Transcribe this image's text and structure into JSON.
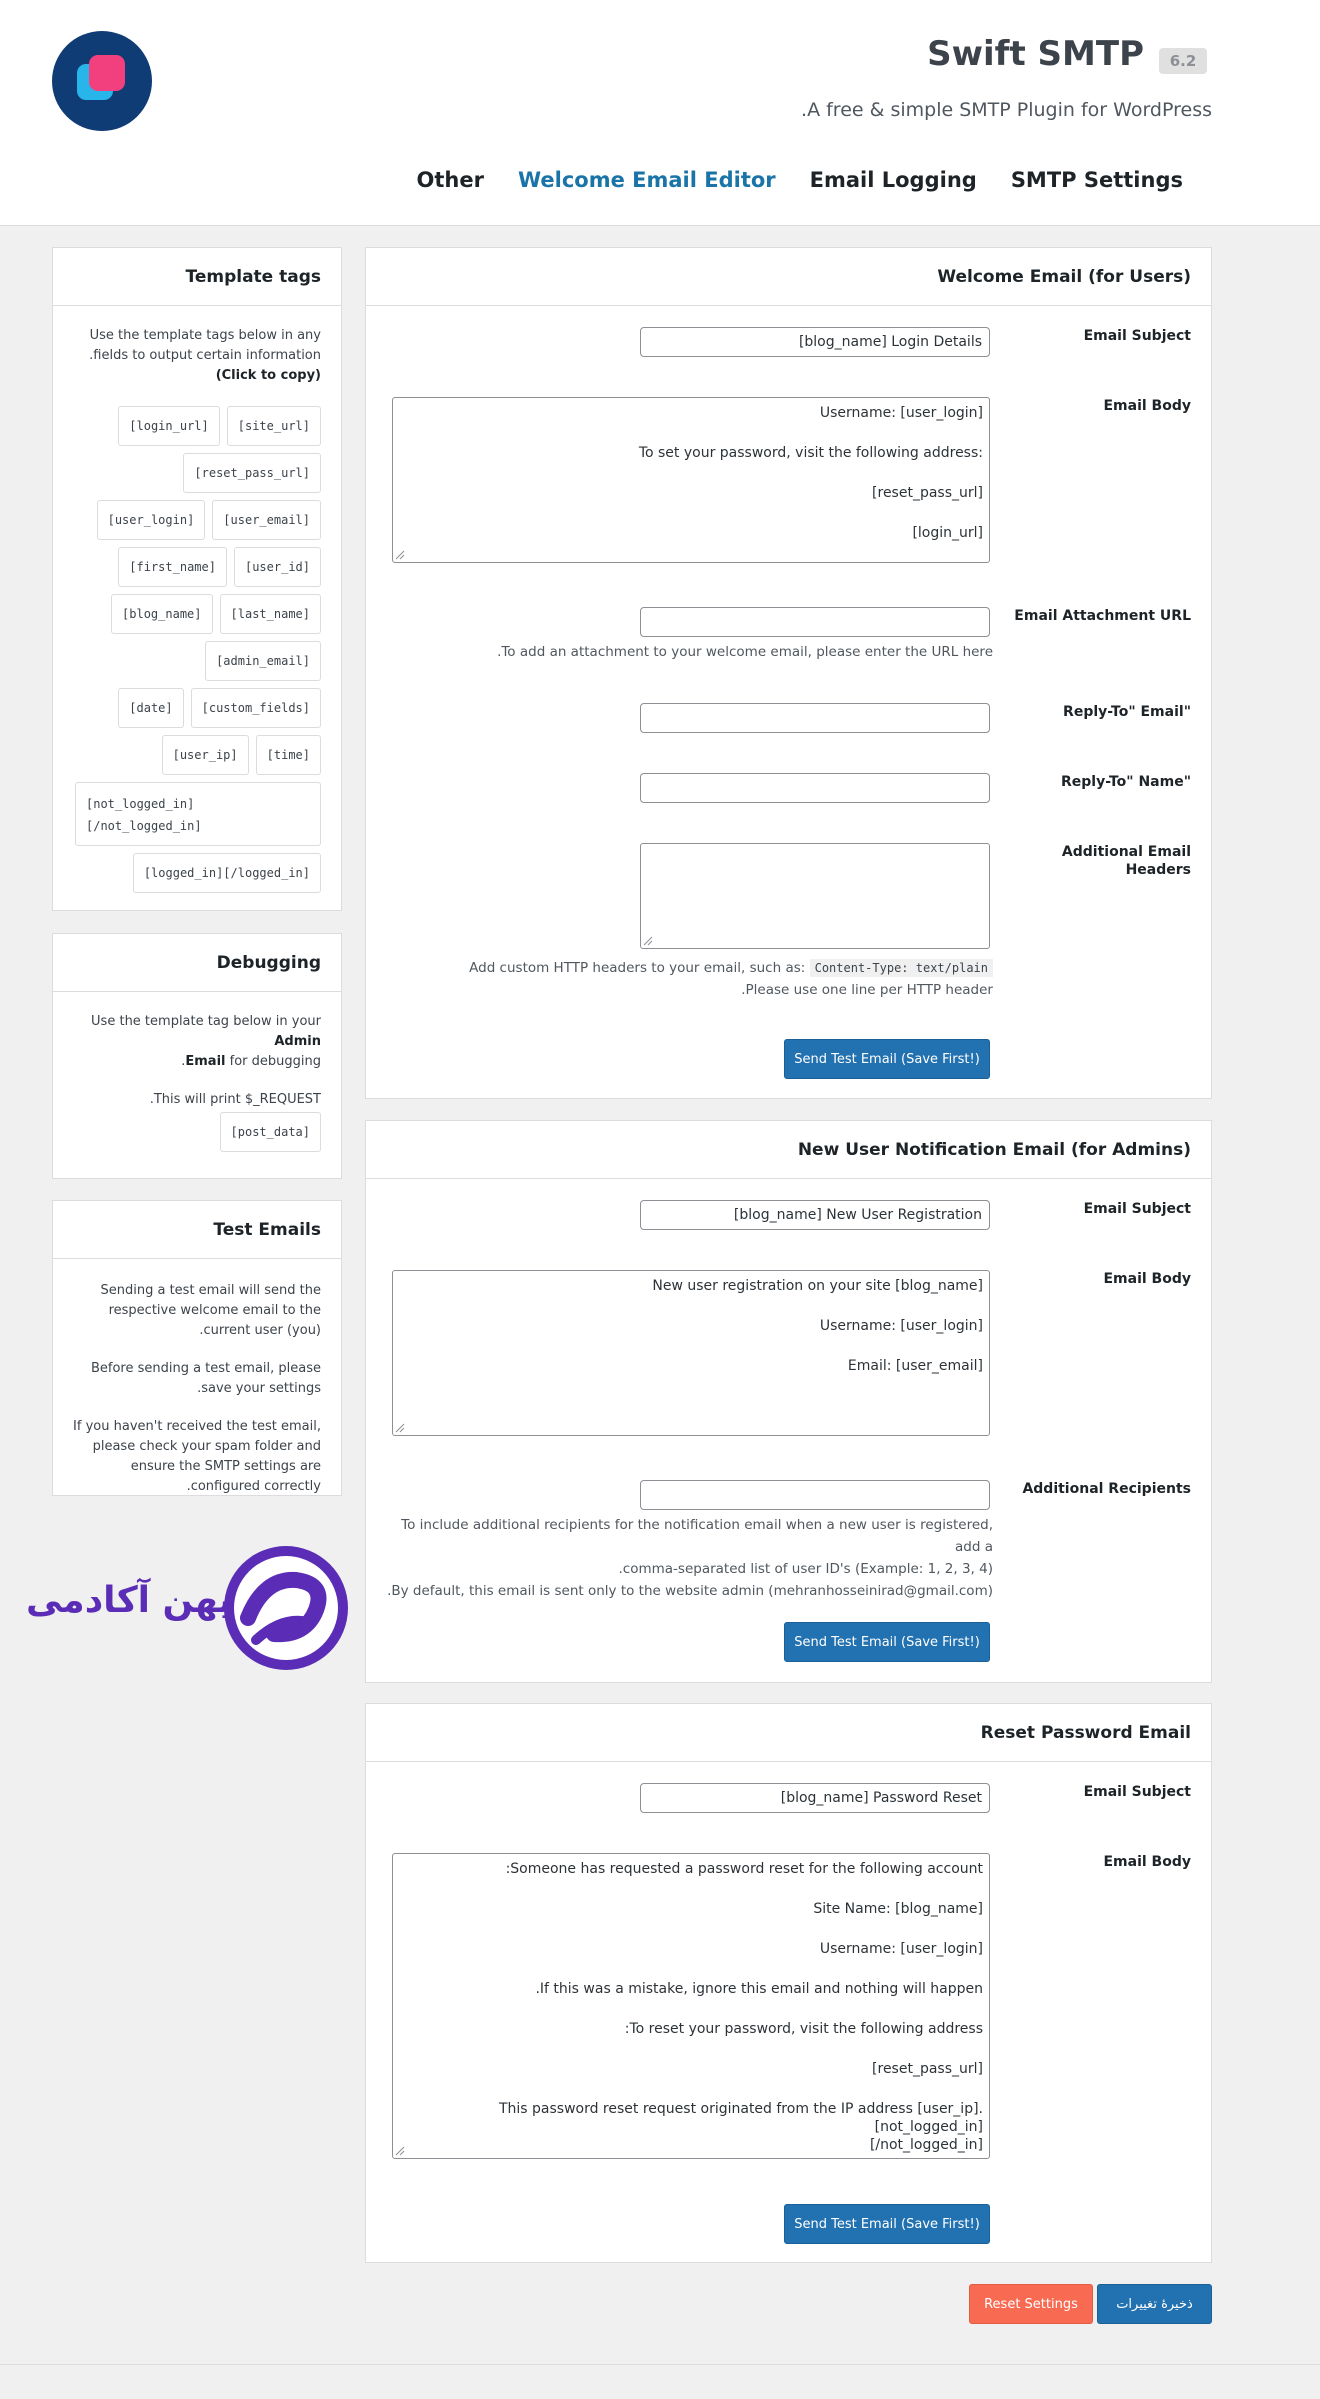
{
  "header": {
    "title": "Swift SMTP",
    "version": "6.2",
    "tagline": "A free & simple SMTP Plugin for WordPress.",
    "nav": [
      {
        "label": "SMTP Settings",
        "active": false
      },
      {
        "label": "Email Logging",
        "active": false
      },
      {
        "label": "Welcome Email Editor",
        "active": true
      },
      {
        "label": "Other",
        "active": false
      }
    ]
  },
  "welcome": {
    "title": "Welcome Email (for Users)",
    "subject_label": "Email Subject",
    "subject_value": "[blog_name] Login Details",
    "body_label": "Email Body",
    "body_lines": [
      "Username: [user_login]",
      "To set your password, visit the following address:",
      "[reset_pass_url]",
      "[login_url]"
    ],
    "attachment_label": "Email Attachment URL",
    "attachment_help": "To add an attachment to your welcome email, please enter the URL here.",
    "reply_email_label": "\"Reply-To\" Email",
    "reply_name_label": "\"Reply-To\" Name",
    "headers_label": "Additional Email Headers",
    "headers_help_1": "Add custom HTTP headers to your email, such as:",
    "headers_help_code": "Content-Type: text/plain",
    "headers_help_2": "Please use one line per HTTP header.",
    "test_button": "Send Test Email (Save First!)"
  },
  "admin_notify": {
    "title": "New User Notification Email (for Admins)",
    "subject_label": "Email Subject",
    "subject_value": "[blog_name] New User Registration",
    "body_label": "Email Body",
    "body_lines": [
      "New user registration on your site [blog_name]",
      "Username: [user_login]",
      "Email: [user_email]"
    ],
    "recipients_label": "Additional Recipients",
    "recipients_help_1": "To include additional recipients for the notification email when a new user is registered, add a",
    "recipients_help_2": "comma-separated list of user ID's (Example: 1, 2, 3, 4).",
    "recipients_help_3": "By default, this email is sent only to the website admin (mehranhosseinirad@gmail.com).",
    "test_button": "Send Test Email (Save First!)"
  },
  "reset": {
    "title": "Reset Password Email",
    "subject_label": "Email Subject",
    "subject_value": "[blog_name] Password Reset",
    "body_label": "Email Body",
    "body_lines": [
      "Someone has requested a password reset for the following account:",
      "Site Name: [blog_name]",
      "Username: [user_login]",
      "If this was a mistake, ignore this email and nothing will happen.",
      "To reset your password, visit the following address:",
      "[reset_pass_url]"
    ],
    "body_last_1": "This password reset request originated from the IP address [user_ip].[not_logged_in]",
    "body_last_2": "[/not_logged_in]",
    "test_button": "Send Test Email (Save First!)"
  },
  "sidebar": {
    "tags_title": "Template tags",
    "tags_intro": "Use the template tags below in any fields to output certain information.",
    "tags_click": "(Click to copy)",
    "tag_rows": [
      [
        "[site_url]",
        "[login_url]"
      ],
      [
        "[reset_pass_url]"
      ],
      [
        "[user_email]",
        "[user_login]"
      ],
      [
        "[user_id]",
        "[first_name]"
      ],
      [
        "[last_name]",
        "[blog_name]"
      ],
      [
        "[admin_email]"
      ],
      [
        "[custom_fields]",
        "[date]"
      ],
      [
        "[time]",
        "[user_ip]"
      ]
    ],
    "tag_multi_1": "[not_logged_in]",
    "tag_multi_2": "[/not_logged_in]",
    "tag_last": "[logged_in][/logged_in]",
    "debug_title": "Debugging",
    "debug_text_1": "Use the template tag below in your",
    "debug_bold_1": "Admin",
    "debug_bold_2": "Email",
    "debug_text_2": "for debugging.",
    "debug_text_3": "This will print $_REQUEST.",
    "debug_tag": "[post_data]",
    "test_title": "Test Emails",
    "test_p1": "Sending a test email will send the respective welcome email to the current user (you).",
    "test_p2": "Before sending a test email, please save your settings.",
    "test_p3": "If you haven't received the test email, please check your spam folder and ensure the SMTP settings are configured correctly."
  },
  "footer": {
    "save_button": "ذخیرهٔ تغییرات",
    "reset_button": "Reset Settings"
  },
  "watermark": {
    "text": "میهن آکادمی"
  },
  "colors": {
    "accent": "#2271b1",
    "nav_active": "#1b74a7",
    "reset_button": "#f86a52",
    "watermark": "#5b2db6"
  }
}
